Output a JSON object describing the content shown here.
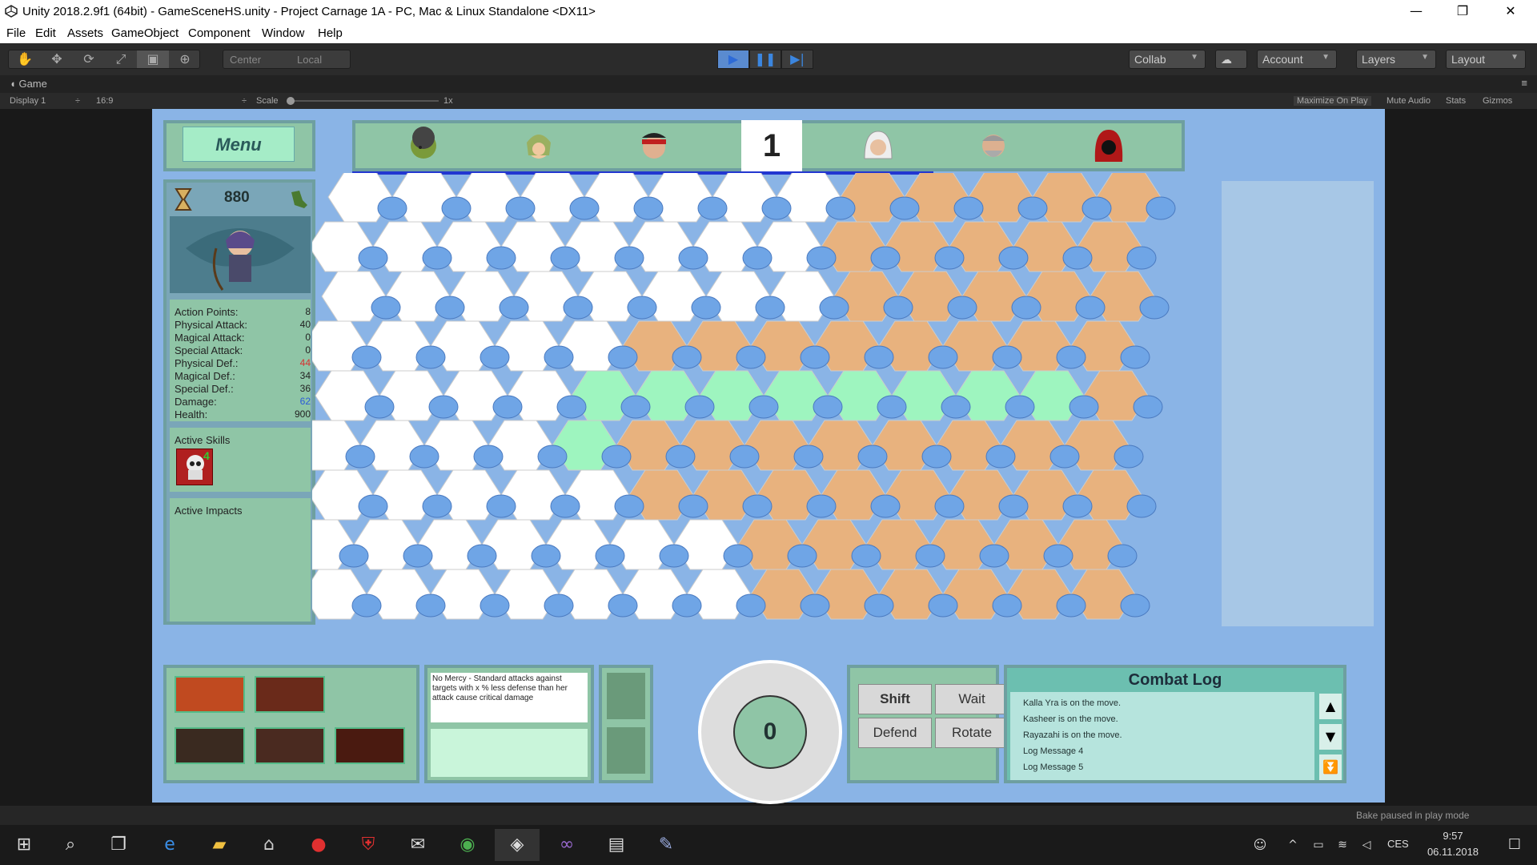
{
  "window": {
    "title": "Unity 2018.2.9f1 (64bit) - GameSceneHS.unity - Project Carnage 1A - PC, Mac & Linux Standalone <DX11>",
    "minimize": "—",
    "maximize": "❐",
    "close": "✕"
  },
  "menu": [
    "File",
    "Edit",
    "Assets",
    "GameObject",
    "Component",
    "Window",
    "Help"
  ],
  "toolbar": {
    "pivot": "Center",
    "space": "Local",
    "collab": "Collab",
    "account": "Account",
    "layers": "Layers",
    "layout": "Layout"
  },
  "gameview": {
    "tab": "Game",
    "display": "Display 1",
    "aspect": "16:9",
    "scale_label": "Scale",
    "scale_value": "1x",
    "maximize_on_play": "Maximize On Play",
    "mute_audio": "Mute Audio",
    "stats": "Stats",
    "gizmos": "Gizmos"
  },
  "hud": {
    "menu_label": "Menu",
    "turn_number": "1",
    "timer_value": "880",
    "stats": [
      {
        "label": "Action Points:",
        "value": "8",
        "color": "#222"
      },
      {
        "label": "Physical Attack:",
        "value": "40",
        "color": "#222"
      },
      {
        "label": "Magical Attack:",
        "value": "0",
        "color": "#222"
      },
      {
        "label": "Special Attack:",
        "value": "0",
        "color": "#222"
      },
      {
        "label": "Physical Def.:",
        "value": "44",
        "color": "#d83030"
      },
      {
        "label": "Magical Def.:",
        "value": "34",
        "color": "#222"
      },
      {
        "label": "Special Def.:",
        "value": "36",
        "color": "#222"
      },
      {
        "label": "Damage:",
        "value": "62",
        "color": "#2a5ad8"
      },
      {
        "label": "Health:",
        "value": "900",
        "color": "#222"
      }
    ],
    "active_skills_label": "Active Skills",
    "active_skills_badge": "4",
    "active_impacts_label": "Active Impacts",
    "skill_description": "No Mercy - Standard attacks against targets with x % less defense than her attack cause critical damage",
    "dial_value": "0",
    "actions": {
      "shift": "Shift",
      "wait": "Wait",
      "defend": "Defend",
      "rotate": "Rotate"
    },
    "combat_log_title": "Combat Log",
    "combat_log": [
      "Kalla Yra is on the move.",
      "Kasheer is on the move.",
      "Rayazahi is on the move.",
      "Log Message 4",
      "Log Message 5"
    ]
  },
  "status": {
    "bake": "Bake paused in play mode"
  },
  "taskbar": {
    "language": "CES",
    "time": "9:57",
    "date": "06.11.2018"
  },
  "colors": {
    "game_bg": "#8ab4e6",
    "hex_white": "#ffffff",
    "hex_orange": "#e8b27e",
    "hex_green": "#9ef5bf",
    "node_blue": "#6fa5e6"
  }
}
